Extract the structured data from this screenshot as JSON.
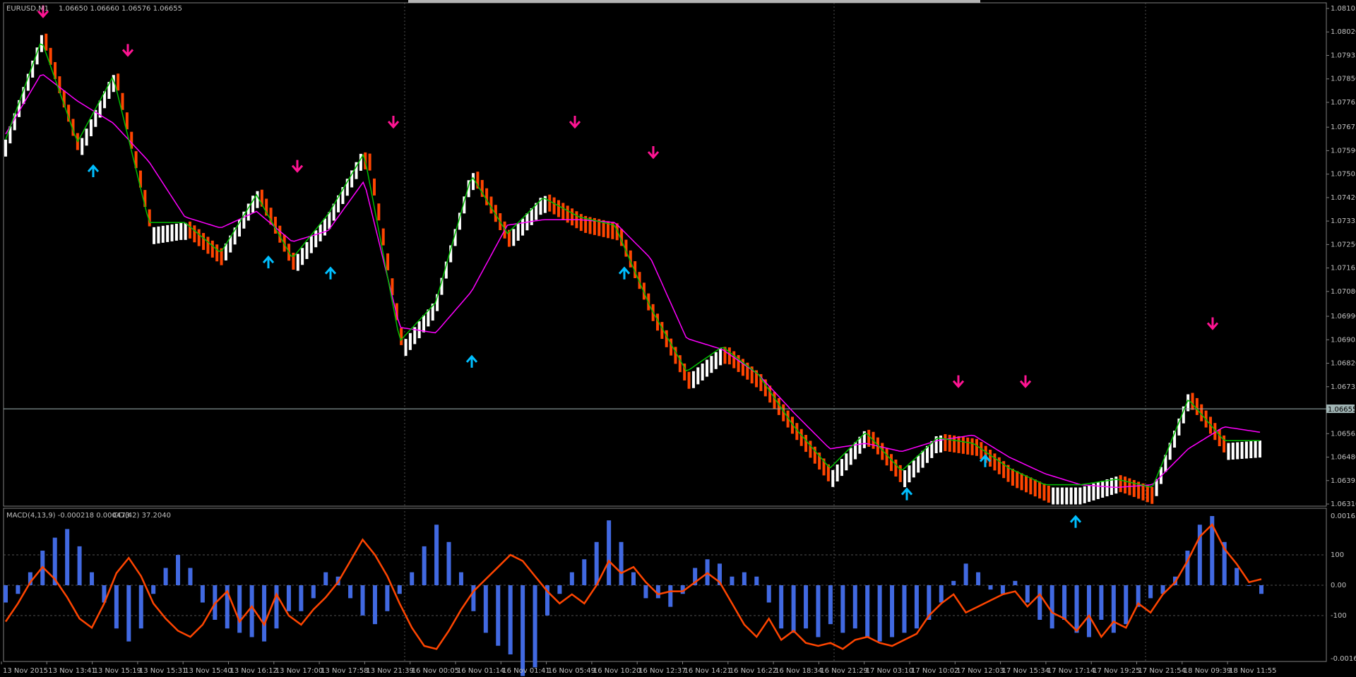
{
  "window": {
    "symbol_header": "EURUSD,M1",
    "ohlc_header": "1.06650 1.06660 1.06576 1.06655",
    "macd_header": "MACD(4,13,9) -0.000218 0.000473",
    "cci_header": "CCI(42) 37.2040",
    "current_price_tag": "1.06655"
  },
  "colors": {
    "background": "#000000",
    "frame": "#808080",
    "bull_bar": "#ffffff",
    "bear_bar": "#ff4500",
    "fast_ma": "#00c000",
    "slow_ma": "#ff00ff",
    "sell_arrow": "#ff1493",
    "buy_arrow": "#00bfff",
    "macd_histogram": "#4169e1",
    "cci_line": "#ff4500",
    "current_price_line": "#a0b4b4"
  },
  "chart_data": [
    {
      "type": "renko-line",
      "symbol": "EURUSD",
      "timeframe": "M1",
      "price_ticks": [
        "1.08105",
        "1.08020",
        "1.07935",
        "1.07850",
        "1.07765",
        "1.07675",
        "1.07590",
        "1.07505",
        "1.07420",
        "1.07335",
        "1.07250",
        "1.07165",
        "1.07080",
        "1.06990",
        "1.06905",
        "1.06820",
        "1.06735",
        "1.06650",
        "1.06565",
        "1.06480",
        "1.06395",
        "1.06310"
      ],
      "ylim": [
        1.0631,
        1.08105
      ],
      "time_labels": [
        "13 Nov 2015",
        "13 Nov 13:41",
        "13 Nov 15:19",
        "13 Nov 15:31",
        "13 Nov 15:40",
        "13 Nov 16:12",
        "13 Nov 17:00",
        "13 Nov 17:58",
        "13 Nov 21:39",
        "16 Nov 00:05",
        "16 Nov 01:14",
        "16 Nov 01:41",
        "16 Nov 05:49",
        "16 Nov 10:20",
        "16 Nov 12:37",
        "16 Nov 14:21",
        "16 Nov 16:22",
        "16 Nov 18:34",
        "16 Nov 21:29",
        "17 Nov 03:10",
        "17 Nov 10:02",
        "17 Nov 12:03",
        "17 Nov 15:34",
        "17 Nov 17:14",
        "17 Nov 19:25",
        "17 Nov 21:54",
        "18 Nov 09:39",
        "18 Nov 11:55"
      ],
      "price_path": [
        1.0763,
        1.0801,
        1.076,
        1.0787,
        1.0731,
        1.0733,
        1.0722,
        1.0745,
        1.0719,
        1.0736,
        1.076,
        1.0688,
        1.0705,
        1.0752,
        1.0728,
        1.0743,
        1.0735,
        1.0732,
        1.0701,
        1.0677,
        1.0688,
        1.0677,
        1.0659,
        1.0642,
        1.0658,
        1.0642,
        1.0656,
        1.0654,
        1.0643,
        1.0637,
        1.0637,
        1.0641,
        1.0636,
        1.0671,
        1.0653,
        1.0654
      ],
      "fast_ma_path": [
        1.0763,
        1.0799,
        1.0762,
        1.0786,
        1.0733,
        1.0733,
        1.0722,
        1.0743,
        1.072,
        1.0736,
        1.0758,
        1.069,
        1.0704,
        1.075,
        1.0729,
        1.0742,
        1.0735,
        1.0732,
        1.0702,
        1.0679,
        1.0688,
        1.0678,
        1.0659,
        1.0644,
        1.0657,
        1.0643,
        1.0655,
        1.0653,
        1.0644,
        1.0638,
        1.0638,
        1.064,
        1.0637,
        1.0669,
        1.0654,
        1.0654
      ],
      "slow_ma_path": [
        1.0765,
        1.0787,
        1.0777,
        1.0769,
        1.0755,
        1.0735,
        1.0731,
        1.0737,
        1.0726,
        1.073,
        1.0748,
        1.0695,
        1.0693,
        1.0708,
        1.0732,
        1.0734,
        1.0734,
        1.0733,
        1.072,
        1.0691,
        1.0687,
        1.0678,
        1.0664,
        1.0651,
        1.0653,
        1.065,
        1.0654,
        1.0656,
        1.0648,
        1.0642,
        1.0638,
        1.0637,
        1.0638,
        1.0651,
        1.0659,
        1.0657
      ],
      "bar_count": 280,
      "sell_signal_prices": [
        1.0806,
        1.0792,
        1.075,
        1.0766,
        1.0766,
        1.0755,
        1.0672,
        1.0672,
        1.0693
      ],
      "buy_signal_prices": [
        1.0755,
        1.0722,
        1.0718,
        1.0686,
        1.0718,
        1.0638,
        1.065,
        1.0628
      ],
      "current_price": 1.06655
    },
    {
      "type": "bar+line",
      "series": [
        {
          "name": "MACD(4,13,9)",
          "kind": "histogram",
          "values": [
            -0.0004,
            -0.0002,
            0.0003,
            0.0008,
            0.0011,
            0.0013,
            0.0009,
            0.0003,
            -0.0004,
            -0.001,
            -0.0013,
            -0.001,
            -0.0002,
            0.0004,
            0.0007,
            0.0004,
            -0.0004,
            -0.0008,
            -0.001,
            -0.0011,
            -0.0012,
            -0.0013,
            -0.001,
            -0.0006,
            -0.0006,
            -0.0003,
            0.0003,
            0.0002,
            -0.0003,
            -0.0007,
            -0.0009,
            -0.0006,
            -0.0002,
            0.0003,
            0.0009,
            0.0014,
            0.001,
            0.0003,
            -0.0006,
            -0.0011,
            -0.0014,
            -0.0016,
            -0.0021,
            -0.0019,
            -0.0007,
            -0.0002,
            0.0003,
            0.0006,
            0.001,
            0.0015,
            0.001,
            0.0003,
            -0.0003,
            -0.0003,
            -0.0005,
            -0.0002,
            0.0004,
            0.0006,
            0.0005,
            0.0002,
            0.0003,
            0.0002,
            -0.0004,
            -0.001,
            -0.0011,
            -0.001,
            -0.0012,
            -0.0009,
            -0.0011,
            -0.001,
            -0.0012,
            -0.0013,
            -0.0012,
            -0.0011,
            -0.001,
            -0.0008,
            -0.0004,
            0.0001,
            0.0005,
            0.0003,
            -0.0001,
            -0.0002,
            0.0001,
            -0.0004,
            -0.0008,
            -0.001,
            -0.0008,
            -0.0011,
            -0.0012,
            -0.0008,
            -0.0011,
            -0.0009,
            -0.0005,
            -0.0003,
            -0.0002,
            0.0002,
            0.0008,
            0.0014,
            0.0016,
            0.001,
            0.0004,
            0.0,
            -0.0002
          ]
        },
        {
          "name": "CCI(42)",
          "kind": "line",
          "values": [
            -120,
            -60,
            10,
            60,
            20,
            -40,
            -110,
            -140,
            -60,
            40,
            90,
            30,
            -60,
            -110,
            -150,
            -170,
            -130,
            -60,
            -20,
            -120,
            -70,
            -130,
            -30,
            -100,
            -130,
            -80,
            -40,
            10,
            80,
            150,
            100,
            30,
            -60,
            -140,
            -200,
            -210,
            -150,
            -80,
            -20,
            20,
            60,
            100,
            80,
            30,
            -20,
            -60,
            -30,
            -60,
            0,
            80,
            40,
            60,
            10,
            -30,
            -20,
            -20,
            10,
            40,
            10,
            -60,
            -130,
            -170,
            -110,
            -180,
            -150,
            -190,
            -200,
            -190,
            -210,
            -180,
            -170,
            -190,
            -200,
            -180,
            -160,
            -100,
            -60,
            -30,
            -90,
            -70,
            -50,
            -30,
            -20,
            -70,
            -30,
            -90,
            -110,
            -150,
            -100,
            -170,
            -120,
            -140,
            -60,
            -90,
            -30,
            10,
            80,
            160,
            200,
            120,
            70,
            10,
            20
          ]
        }
      ],
      "ylim": [
        -0.0016,
        0.0016
      ],
      "ticks": [
        "0.001631",
        "100",
        "0.00",
        "-100",
        "-0.00163"
      ]
    }
  ]
}
